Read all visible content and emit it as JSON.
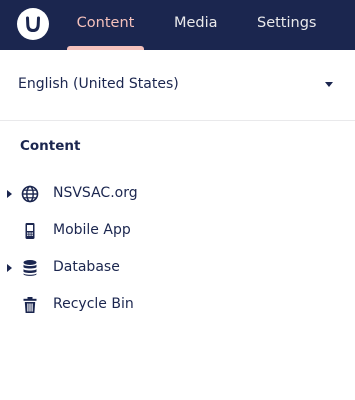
{
  "header": {
    "logo_icon": "umbraco-logo-icon",
    "tabs": [
      {
        "label": "Content",
        "active": true
      },
      {
        "label": "Media",
        "active": false
      },
      {
        "label": "Settings",
        "active": false
      }
    ]
  },
  "language": {
    "selected": "English (United States)",
    "icon": "chevron-down-icon"
  },
  "tree": {
    "section_title": "Content",
    "items": [
      {
        "label": "NSVSAC.org",
        "icon": "globe-icon",
        "expandable": true
      },
      {
        "label": "Mobile App",
        "icon": "mobile-phone-icon",
        "expandable": false
      },
      {
        "label": "Database",
        "icon": "database-icon",
        "expandable": true
      },
      {
        "label": "Recycle Bin",
        "icon": "trash-icon",
        "expandable": false
      }
    ]
  },
  "colors": {
    "header_bg": "#1b264f",
    "active_tab": "#f5c1bc",
    "text": "#1b264f"
  }
}
